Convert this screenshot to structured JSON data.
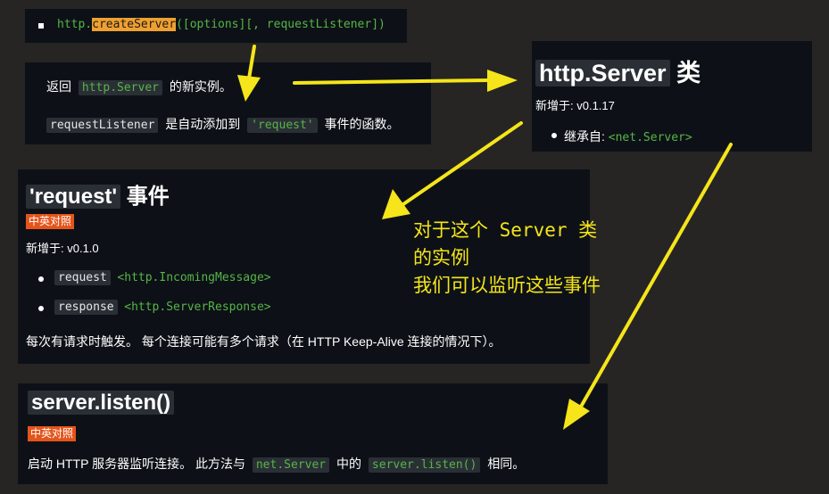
{
  "signature": {
    "prefix": "http.",
    "fn": "createServer",
    "args": "([options][, requestListener])"
  },
  "returns": {
    "before": "返回",
    "code": "http.Server",
    "after": "的新实例。",
    "listener_code": "requestListener",
    "listener_mid": "是自动添加到",
    "event_code": "'request'",
    "listener_after": "事件的函数。"
  },
  "server_class": {
    "title_code": "http.Server",
    "title_suffix": "类",
    "added": "新增于: v0.1.17",
    "extends_label": "继承自:",
    "extends_value": "<net.Server>"
  },
  "request_event": {
    "title_code": "'request'",
    "title_suffix": "事件",
    "badge": "中英对照",
    "added": "新增于: v0.1.0",
    "params": [
      {
        "name": "request",
        "type": "<http.IncomingMessage>"
      },
      {
        "name": "response",
        "type": "<http.ServerResponse>"
      }
    ],
    "desc": "每次有请求时触发。 每个连接可能有多个请求（在 HTTP Keep-Alive 连接的情况下）。"
  },
  "listen": {
    "title_code": "server.listen()",
    "badge": "中英对照",
    "desc_before": "启动 HTTP 服务器监听连接。 此方法与",
    "code1": "net.Server",
    "desc_mid": "中的",
    "code2": "server.listen()",
    "desc_after": "相同。"
  },
  "annotation": {
    "line1": "对于这个 Server 类",
    "line2": "的实例",
    "line3": "我们可以监听这些事件"
  },
  "colors": {
    "background": "#262523",
    "panel": "#0d1117",
    "code_green": "#57b547",
    "highlight_orange": "#f0a030",
    "badge_orange": "#e5541b",
    "annotation_yellow": "#f5e51a"
  }
}
